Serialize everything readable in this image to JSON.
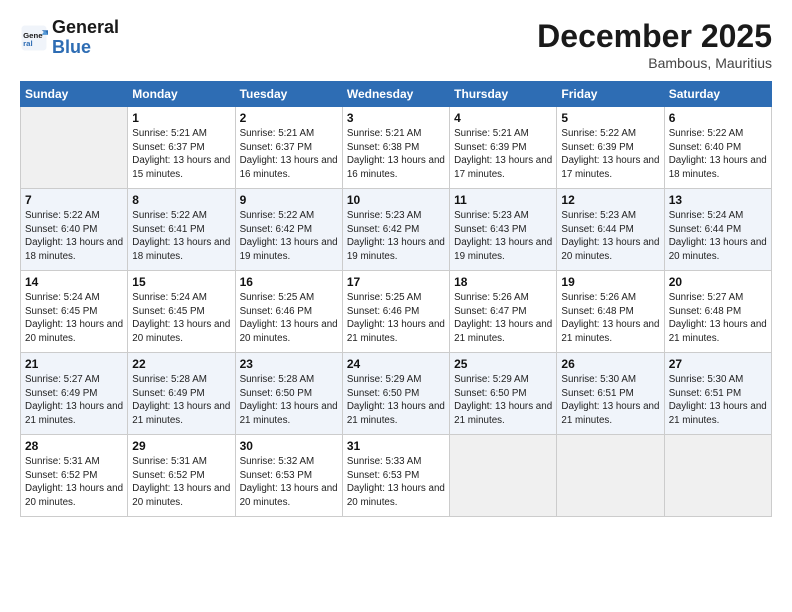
{
  "logo": {
    "general": "General",
    "blue": "Blue"
  },
  "header": {
    "title": "December 2025",
    "location": "Bambous, Mauritius"
  },
  "days_of_week": [
    "Sunday",
    "Monday",
    "Tuesday",
    "Wednesday",
    "Thursday",
    "Friday",
    "Saturday"
  ],
  "weeks": [
    [
      {
        "day": "",
        "sunrise": "",
        "sunset": "",
        "daylight": ""
      },
      {
        "day": "1",
        "sunrise": "Sunrise: 5:21 AM",
        "sunset": "Sunset: 6:37 PM",
        "daylight": "Daylight: 13 hours and 15 minutes."
      },
      {
        "day": "2",
        "sunrise": "Sunrise: 5:21 AM",
        "sunset": "Sunset: 6:37 PM",
        "daylight": "Daylight: 13 hours and 16 minutes."
      },
      {
        "day": "3",
        "sunrise": "Sunrise: 5:21 AM",
        "sunset": "Sunset: 6:38 PM",
        "daylight": "Daylight: 13 hours and 16 minutes."
      },
      {
        "day": "4",
        "sunrise": "Sunrise: 5:21 AM",
        "sunset": "Sunset: 6:39 PM",
        "daylight": "Daylight: 13 hours and 17 minutes."
      },
      {
        "day": "5",
        "sunrise": "Sunrise: 5:22 AM",
        "sunset": "Sunset: 6:39 PM",
        "daylight": "Daylight: 13 hours and 17 minutes."
      },
      {
        "day": "6",
        "sunrise": "Sunrise: 5:22 AM",
        "sunset": "Sunset: 6:40 PM",
        "daylight": "Daylight: 13 hours and 18 minutes."
      }
    ],
    [
      {
        "day": "7",
        "sunrise": "Sunrise: 5:22 AM",
        "sunset": "Sunset: 6:40 PM",
        "daylight": "Daylight: 13 hours and 18 minutes."
      },
      {
        "day": "8",
        "sunrise": "Sunrise: 5:22 AM",
        "sunset": "Sunset: 6:41 PM",
        "daylight": "Daylight: 13 hours and 18 minutes."
      },
      {
        "day": "9",
        "sunrise": "Sunrise: 5:22 AM",
        "sunset": "Sunset: 6:42 PM",
        "daylight": "Daylight: 13 hours and 19 minutes."
      },
      {
        "day": "10",
        "sunrise": "Sunrise: 5:23 AM",
        "sunset": "Sunset: 6:42 PM",
        "daylight": "Daylight: 13 hours and 19 minutes."
      },
      {
        "day": "11",
        "sunrise": "Sunrise: 5:23 AM",
        "sunset": "Sunset: 6:43 PM",
        "daylight": "Daylight: 13 hours and 19 minutes."
      },
      {
        "day": "12",
        "sunrise": "Sunrise: 5:23 AM",
        "sunset": "Sunset: 6:44 PM",
        "daylight": "Daylight: 13 hours and 20 minutes."
      },
      {
        "day": "13",
        "sunrise": "Sunrise: 5:24 AM",
        "sunset": "Sunset: 6:44 PM",
        "daylight": "Daylight: 13 hours and 20 minutes."
      }
    ],
    [
      {
        "day": "14",
        "sunrise": "Sunrise: 5:24 AM",
        "sunset": "Sunset: 6:45 PM",
        "daylight": "Daylight: 13 hours and 20 minutes."
      },
      {
        "day": "15",
        "sunrise": "Sunrise: 5:24 AM",
        "sunset": "Sunset: 6:45 PM",
        "daylight": "Daylight: 13 hours and 20 minutes."
      },
      {
        "day": "16",
        "sunrise": "Sunrise: 5:25 AM",
        "sunset": "Sunset: 6:46 PM",
        "daylight": "Daylight: 13 hours and 20 minutes."
      },
      {
        "day": "17",
        "sunrise": "Sunrise: 5:25 AM",
        "sunset": "Sunset: 6:46 PM",
        "daylight": "Daylight: 13 hours and 21 minutes."
      },
      {
        "day": "18",
        "sunrise": "Sunrise: 5:26 AM",
        "sunset": "Sunset: 6:47 PM",
        "daylight": "Daylight: 13 hours and 21 minutes."
      },
      {
        "day": "19",
        "sunrise": "Sunrise: 5:26 AM",
        "sunset": "Sunset: 6:48 PM",
        "daylight": "Daylight: 13 hours and 21 minutes."
      },
      {
        "day": "20",
        "sunrise": "Sunrise: 5:27 AM",
        "sunset": "Sunset: 6:48 PM",
        "daylight": "Daylight: 13 hours and 21 minutes."
      }
    ],
    [
      {
        "day": "21",
        "sunrise": "Sunrise: 5:27 AM",
        "sunset": "Sunset: 6:49 PM",
        "daylight": "Daylight: 13 hours and 21 minutes."
      },
      {
        "day": "22",
        "sunrise": "Sunrise: 5:28 AM",
        "sunset": "Sunset: 6:49 PM",
        "daylight": "Daylight: 13 hours and 21 minutes."
      },
      {
        "day": "23",
        "sunrise": "Sunrise: 5:28 AM",
        "sunset": "Sunset: 6:50 PM",
        "daylight": "Daylight: 13 hours and 21 minutes."
      },
      {
        "day": "24",
        "sunrise": "Sunrise: 5:29 AM",
        "sunset": "Sunset: 6:50 PM",
        "daylight": "Daylight: 13 hours and 21 minutes."
      },
      {
        "day": "25",
        "sunrise": "Sunrise: 5:29 AM",
        "sunset": "Sunset: 6:50 PM",
        "daylight": "Daylight: 13 hours and 21 minutes."
      },
      {
        "day": "26",
        "sunrise": "Sunrise: 5:30 AM",
        "sunset": "Sunset: 6:51 PM",
        "daylight": "Daylight: 13 hours and 21 minutes."
      },
      {
        "day": "27",
        "sunrise": "Sunrise: 5:30 AM",
        "sunset": "Sunset: 6:51 PM",
        "daylight": "Daylight: 13 hours and 21 minutes."
      }
    ],
    [
      {
        "day": "28",
        "sunrise": "Sunrise: 5:31 AM",
        "sunset": "Sunset: 6:52 PM",
        "daylight": "Daylight: 13 hours and 20 minutes."
      },
      {
        "day": "29",
        "sunrise": "Sunrise: 5:31 AM",
        "sunset": "Sunset: 6:52 PM",
        "daylight": "Daylight: 13 hours and 20 minutes."
      },
      {
        "day": "30",
        "sunrise": "Sunrise: 5:32 AM",
        "sunset": "Sunset: 6:53 PM",
        "daylight": "Daylight: 13 hours and 20 minutes."
      },
      {
        "day": "31",
        "sunrise": "Sunrise: 5:33 AM",
        "sunset": "Sunset: 6:53 PM",
        "daylight": "Daylight: 13 hours and 20 minutes."
      },
      {
        "day": "",
        "sunrise": "",
        "sunset": "",
        "daylight": ""
      },
      {
        "day": "",
        "sunrise": "",
        "sunset": "",
        "daylight": ""
      },
      {
        "day": "",
        "sunrise": "",
        "sunset": "",
        "daylight": ""
      }
    ]
  ]
}
